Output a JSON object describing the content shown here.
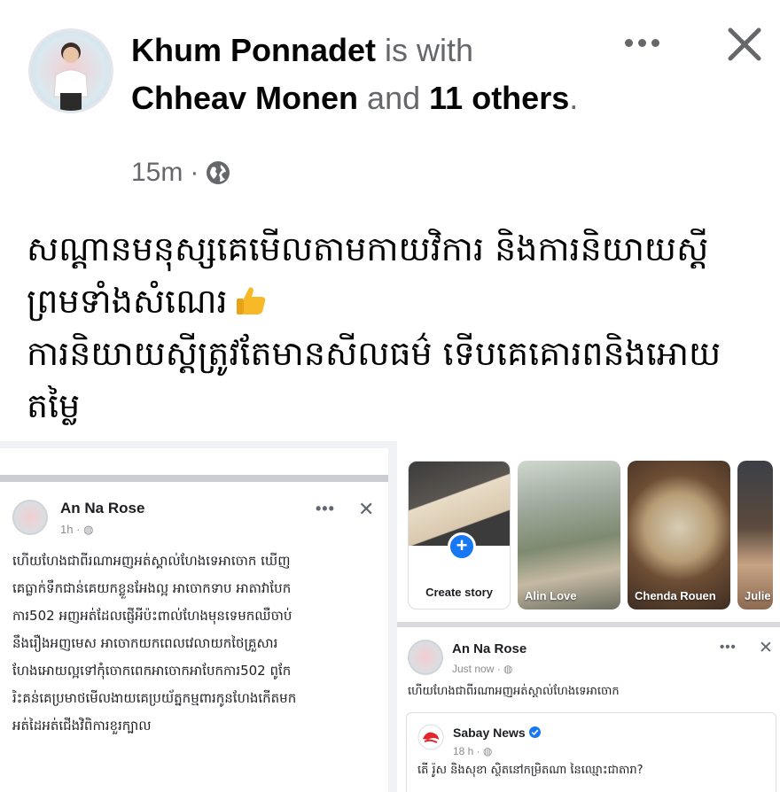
{
  "post": {
    "author": "Khum Ponnadet",
    "with_text": "is with",
    "tagged": "Chheav Monen",
    "and_text": "and",
    "others": "11 others",
    "period": ".",
    "time": "15m",
    "separator": "·",
    "privacy_icon": "globe-icon",
    "text_lines": [
      "សណ្ដានមនុស្សគេមើលតាមកាយវិការ និងការនិយាយស្ដី",
      "ព្រមទាំងសំណេរ",
      "ការនិយាយស្ដីត្រូវតែមានសីលធម៌ ទើបគេគោរពនិងអោយ",
      "តម្លៃ"
    ],
    "emoji": "thumbs-up-icon"
  },
  "left_shot": {
    "author": "An Na Rose",
    "time": "1h",
    "separator": "·",
    "text_lines": [
      "ហើយហែងជាពីរណាអញអត់ស្គាល់ហែងទេអាចោក ឃើញ",
      "គេធ្លាក់ទឹកជាន់គេយកខ្លួនអែងល្អ អាចោកទាប អាតាវាបែក",
      "ការ502 អញអត់ដែលផ្ញើអីប៉ះពាល់ហែងមុនទេមកឈឺចាប់",
      "នឹងរឿងអញមេស អាចោកយកពេលវេលាយកថៃគ្រួសារ",
      "ហែងអោយល្អទៅកុំចោកពេកអាចោកអាបែកការ502 ពូកែ",
      "រិះគន់គេប្រមាថមើលងាយគេប្រយ័ត្នកម្មពារកូនហែងកើតមក",
      "អត់ដៃអត់ជើងវិពិការខួរក្បាល"
    ]
  },
  "right_shot": {
    "stories": [
      {
        "label": "Create story",
        "kind": "create"
      },
      {
        "label": "Alin Love"
      },
      {
        "label": "Chenda Rouen"
      },
      {
        "label": "Julie R"
      }
    ],
    "post": {
      "author": "An Na Rose",
      "time": "Just now",
      "separator": "·",
      "text": "ហើយហែងជាពីរណាអញអត់ស្គាល់ហែងទេអាចោក"
    },
    "shared": {
      "author": "Sabay News",
      "time": "18 h",
      "separator": "·",
      "text": "តើ រ៉ូស និងសុខា ស្ថិតនៅកម្រិតណា នៃឈ្មោះជាតារា?"
    }
  },
  "colors": {
    "secondary_text": "#65676b",
    "link_blue": "#1877f2",
    "verified_blue": "#1877f2",
    "thumb_yellow": "#f7b928"
  }
}
